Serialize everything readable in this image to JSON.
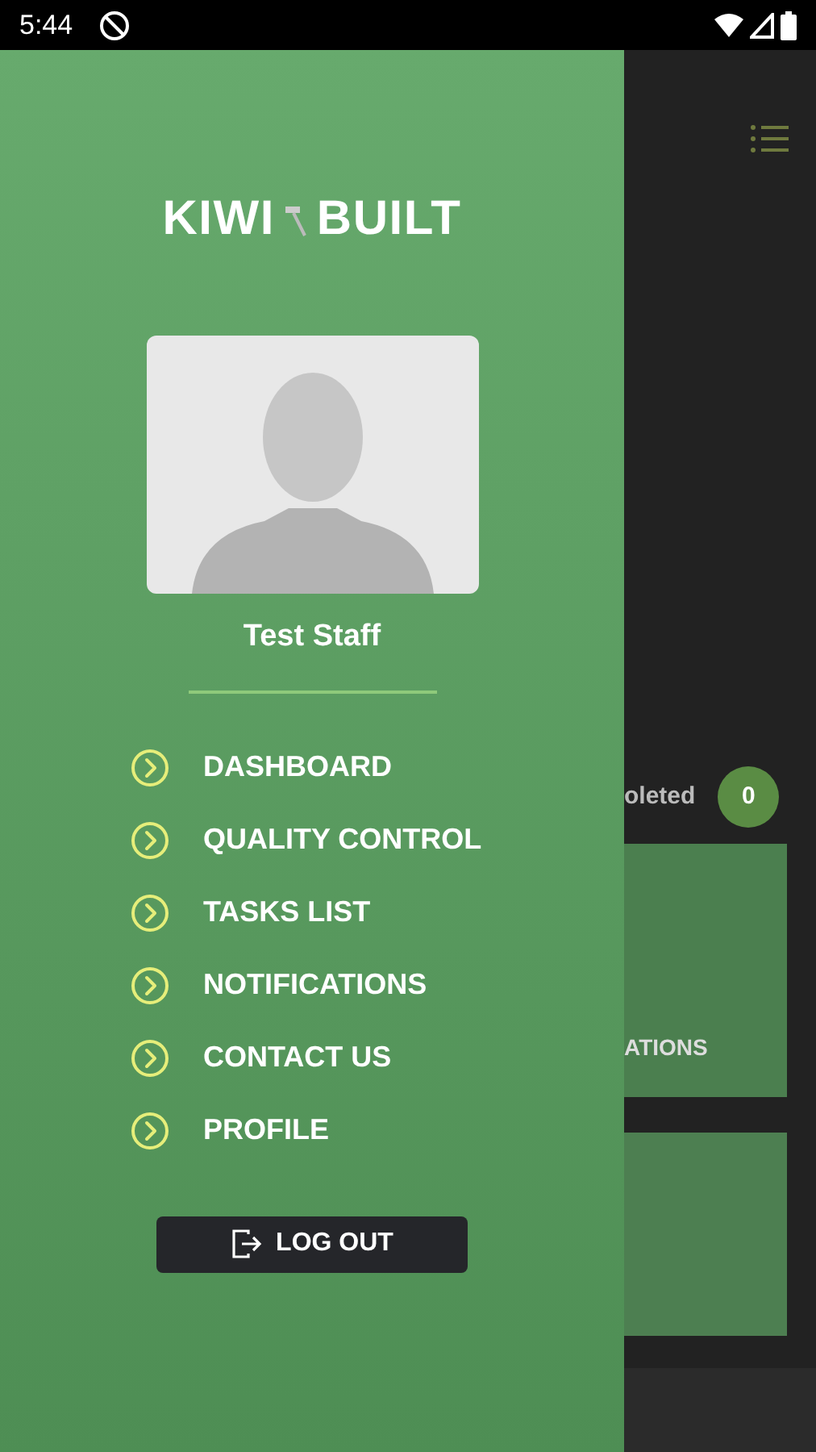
{
  "status_bar": {
    "time": "5:44"
  },
  "drawer": {
    "logo": [
      "KIWI",
      "BUILT"
    ],
    "user_name": "Test Staff",
    "menu": [
      {
        "label": "DASHBOARD"
      },
      {
        "label": "QUALITY CONTROL"
      },
      {
        "label": "TASKS LIST"
      },
      {
        "label": "NOTIFICATIONS"
      },
      {
        "label": "CONTACT US"
      },
      {
        "label": "PROFILE"
      }
    ],
    "logout_button": "LOG OUT"
  },
  "background": {
    "completed_label": "oleted",
    "completed_count": "0",
    "tile_label": "ATIONS"
  }
}
